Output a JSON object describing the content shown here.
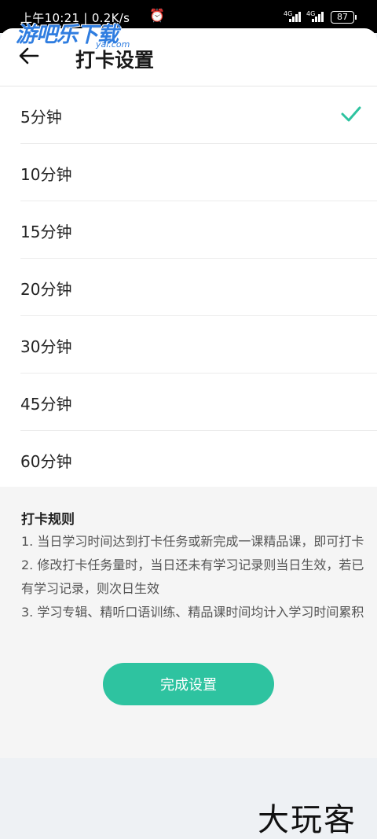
{
  "status_bar": {
    "time": "上午10:21 | 0.2K/s",
    "signal_1": "4G",
    "signal_2": "4G",
    "battery": "87"
  },
  "watermark": {
    "main": "游吧乐下载",
    "sub": "yal.com"
  },
  "header": {
    "title": "打卡设置"
  },
  "options": [
    {
      "label": "5分钟",
      "selected": true
    },
    {
      "label": "10分钟",
      "selected": false
    },
    {
      "label": "15分钟",
      "selected": false
    },
    {
      "label": "20分钟",
      "selected": false
    },
    {
      "label": "30分钟",
      "selected": false
    },
    {
      "label": "45分钟",
      "selected": false
    },
    {
      "label": "60分钟",
      "selected": false
    }
  ],
  "rules": {
    "title": "打卡规则",
    "items": [
      "1. 当日学习时间达到打卡任务或新完成一课精品课，即可打卡",
      "2. 修改打卡任务量时，当日还未有学习记录则当日生效，若已有学习记录，则次日生效",
      "3. 学习专辑、精听口语训练、精品课时间均计入学习时间累积"
    ]
  },
  "finish_button": {
    "label": "完成设置"
  },
  "footer_mark": "大玩客",
  "colors": {
    "accent": "#2ec3a0",
    "check": "#2ec3a0"
  }
}
